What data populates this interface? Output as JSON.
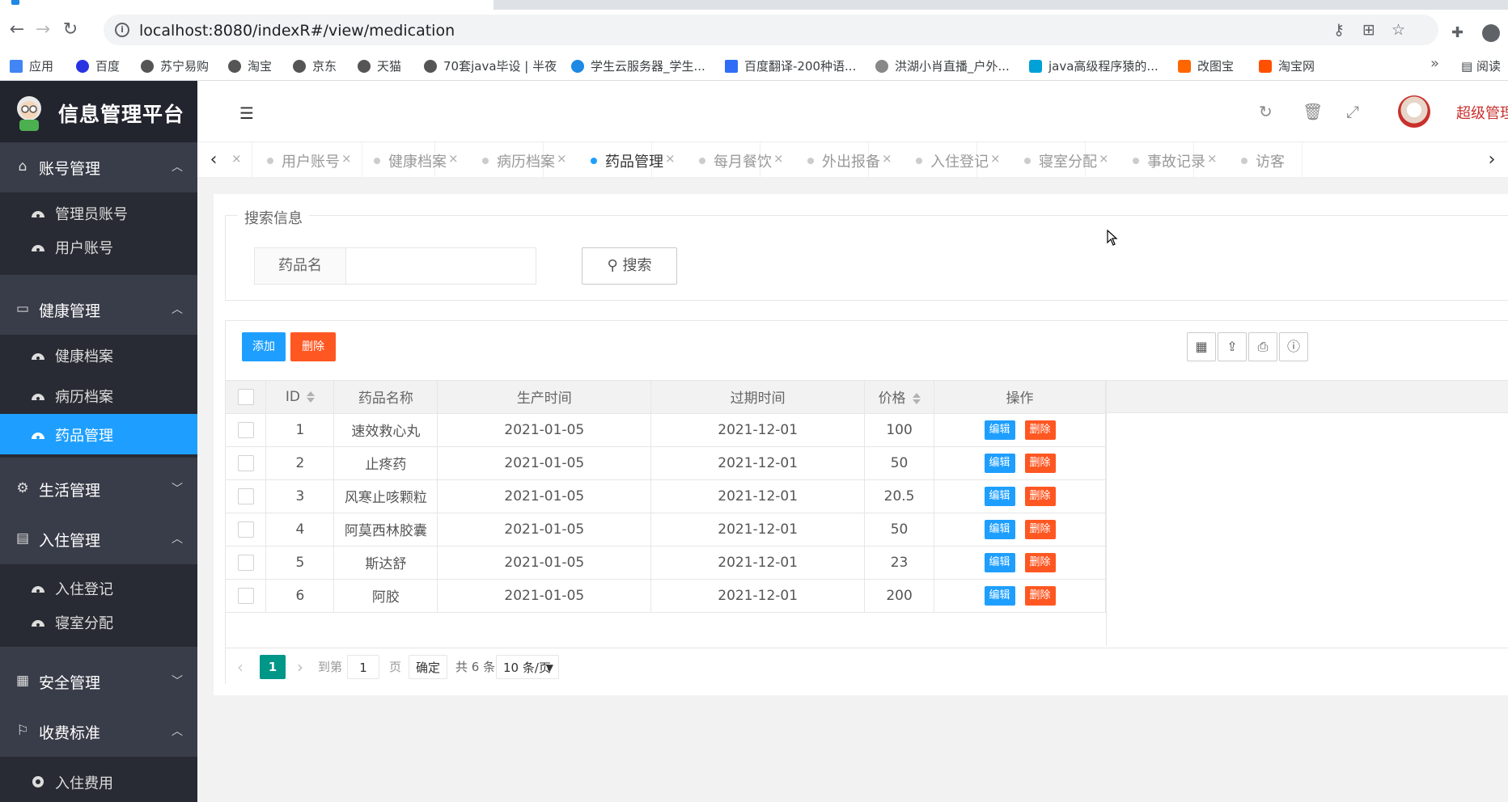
{
  "browser": {
    "url": "localhost:8080/indexR#/view/medication",
    "bookmarks": [
      {
        "label": "应用",
        "color": "#4285f4"
      },
      {
        "label": "百度",
        "color": "#2932e1"
      },
      {
        "label": "苏宁易购",
        "color": "#555555"
      },
      {
        "label": "淘宝",
        "color": "#555555"
      },
      {
        "label": "京东",
        "color": "#555555"
      },
      {
        "label": "天猫",
        "color": "#555555"
      },
      {
        "label": "70套java毕设 | 半夜",
        "color": "#555555"
      },
      {
        "label": "学生云服务器_学生...",
        "color": "#1e88e5"
      },
      {
        "label": "百度翻译-200种语...",
        "color": "#2f6df6"
      },
      {
        "label": "洪湖小肖直播_户外...",
        "color": "#888888"
      },
      {
        "label": "java高级程序猿的...",
        "color": "#00a1d6"
      },
      {
        "label": "改图宝",
        "color": "#ff6600"
      },
      {
        "label": "淘宝网",
        "color": "#ff5000"
      }
    ],
    "more": "»",
    "reading_list": "阅读"
  },
  "app": {
    "title": "信息管理平台",
    "admin_name": "超级管理"
  },
  "sidebar": {
    "groups": [
      {
        "label": "账号管理",
        "icon": "home-icon",
        "arrow": "^",
        "items": [
          "管理员账号",
          "用户账号"
        ]
      },
      {
        "label": "健康管理",
        "icon": "window-icon",
        "arrow": "^",
        "items": [
          "健康档案",
          "病历档案",
          "药品管理"
        ]
      },
      {
        "label": "生活管理",
        "icon": "gears-icon",
        "arrow": "v",
        "items": []
      },
      {
        "label": "入住管理",
        "icon": "file-icon",
        "arrow": "^",
        "items": [
          "入住登记",
          "寝室分配"
        ]
      },
      {
        "label": "安全管理",
        "icon": "calendar-icon",
        "arrow": "v",
        "items": []
      },
      {
        "label": "收费标准",
        "icon": "flag-icon",
        "arrow": "^",
        "items": [
          "入住费用"
        ]
      }
    ],
    "active_item": "药品管理"
  },
  "tabs": {
    "items": [
      "用户账号",
      "健康档案",
      "病历档案",
      "药品管理",
      "每月餐饮",
      "外出报备",
      "入住登记",
      "寝室分配",
      "事故记录",
      "访客"
    ],
    "active": "药品管理"
  },
  "search": {
    "legend": "搜索信息",
    "field_label": "药品名",
    "value": "",
    "button_label": "搜索"
  },
  "toolbar": {
    "add_label": "添加",
    "delete_label": "删除"
  },
  "table": {
    "columns": [
      "ID",
      "药品名称",
      "生产时间",
      "过期时间",
      "价格",
      "操作"
    ],
    "rows": [
      {
        "id": "1",
        "name": "速效救心丸",
        "produced": "2021-01-05",
        "expires": "2021-12-01",
        "price": "100"
      },
      {
        "id": "2",
        "name": "止疼药",
        "produced": "2021-01-05",
        "expires": "2021-12-01",
        "price": "50"
      },
      {
        "id": "3",
        "name": "风寒止咳颗粒",
        "produced": "2021-01-05",
        "expires": "2021-12-01",
        "price": "20.5"
      },
      {
        "id": "4",
        "name": "阿莫西林胶囊",
        "produced": "2021-01-05",
        "expires": "2021-12-01",
        "price": "50"
      },
      {
        "id": "5",
        "name": "斯达舒",
        "produced": "2021-01-05",
        "expires": "2021-12-01",
        "price": "23"
      },
      {
        "id": "6",
        "name": "阿胶",
        "produced": "2021-01-05",
        "expires": "2021-12-01",
        "price": "200"
      }
    ],
    "row_edit_label": "编辑",
    "row_delete_label": "删除"
  },
  "pagination": {
    "current_page": "1",
    "goto_label": "到第",
    "goto_value": "1",
    "page_suffix": "页",
    "confirm_label": "确定",
    "total_label": "共 6 条",
    "page_size": "10 条/页"
  }
}
